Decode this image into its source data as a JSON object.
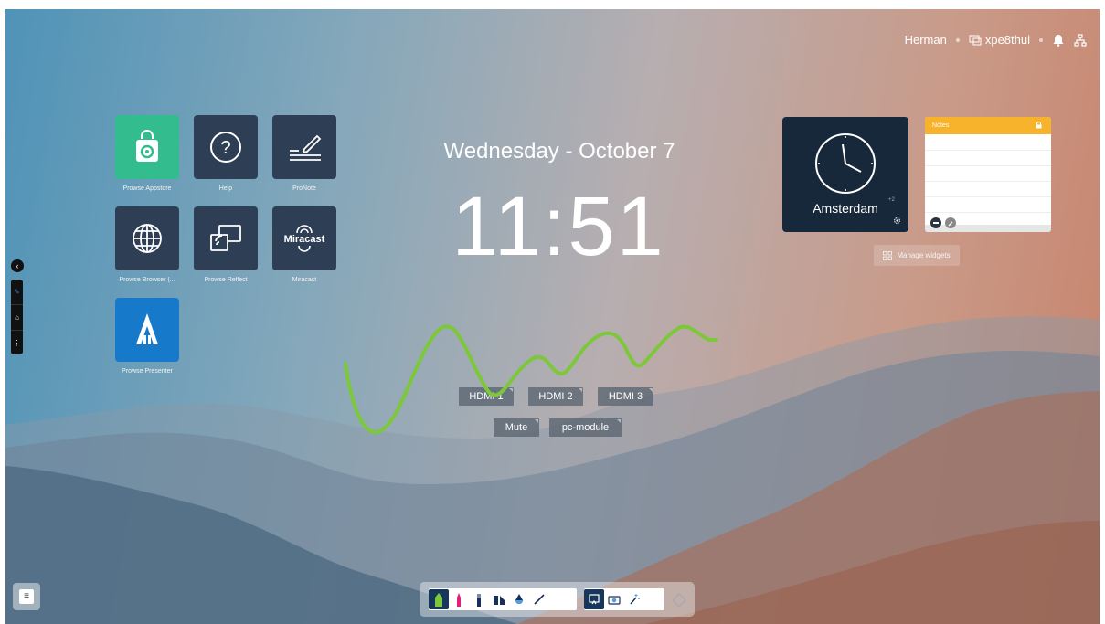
{
  "status": {
    "user": "Herman",
    "device": "xpe8thui"
  },
  "apps": [
    {
      "label": "Prowse Appstore",
      "icon": "appstore-bag-icon"
    },
    {
      "label": "Help",
      "icon": "help-icon"
    },
    {
      "label": "ProNote",
      "icon": "pronote-icon"
    },
    {
      "label": "Prowse Browser (...",
      "icon": "globe-icon"
    },
    {
      "label": "Prowse Reflect",
      "icon": "reflect-icon"
    },
    {
      "label": "Miracast",
      "icon": "miracast-icon"
    },
    {
      "label": "Prowse Presenter",
      "icon": "presenter-icon"
    }
  ],
  "clock": {
    "date": "Wednesday - October 7",
    "time": "11:51"
  },
  "widgets": {
    "clock_city": "Amsterdam",
    "clock_offset": "+2",
    "notes_title": "Notes",
    "manage_label": "Manage widgets"
  },
  "sources": {
    "hdmi1": "HDMI 1",
    "hdmi2": "HDMI 2",
    "hdmi3": "HDMI 3",
    "mute": "Mute",
    "pcmodule": "pc-module"
  },
  "miracast_text": "Miracast",
  "colors": {
    "accent_green": "#7cc83a",
    "tile_dark": "#2e3e54",
    "appstore_green": "#33bd8e",
    "presenter_blue": "#1779c9",
    "notes_yellow": "#f7b32b",
    "clock_bg": "#17283b"
  }
}
